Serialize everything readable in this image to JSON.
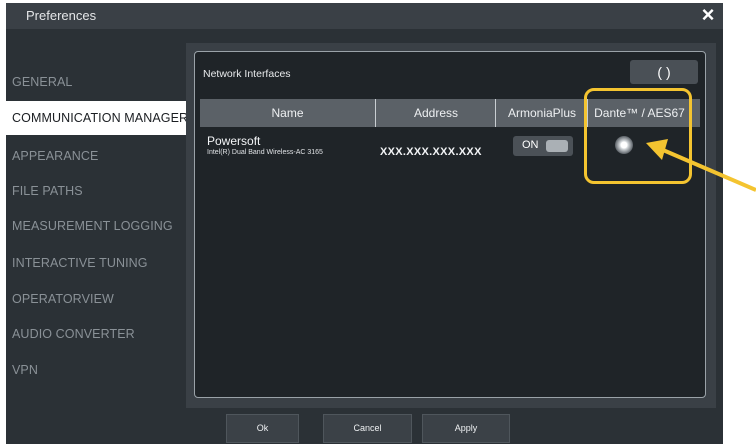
{
  "window": {
    "title": "Preferences",
    "close_icon": "×"
  },
  "sidebar": {
    "items": [
      {
        "label": "GENERAL",
        "active": false
      },
      {
        "label": "COMMUNICATION MANAGER",
        "active": true
      },
      {
        "label": "APPEARANCE",
        "active": false
      },
      {
        "label": "FILE PATHS",
        "active": false
      },
      {
        "label": "MEASUREMENT LOGGING",
        "active": false
      },
      {
        "label": "INTERACTIVE TUNING",
        "active": false
      },
      {
        "label": "OPERATORVIEW",
        "active": false
      },
      {
        "label": "AUDIO CONVERTER",
        "active": false
      },
      {
        "label": "VPN",
        "active": false
      }
    ]
  },
  "panel": {
    "label": "Network Interfaces",
    "refresh_icon": "refresh-icon",
    "refresh_glyph": "( )",
    "columns": [
      "Name",
      "Address",
      "ArmoniaPlus",
      "Dante™ / AES67"
    ],
    "rows": [
      {
        "name": "Powersoft",
        "adapter": "Intel(R) Dual Band Wireless-AC 3165",
        "address": "XXX.XXX.XXX.XXX",
        "armonia_toggle": "ON",
        "dante_selected": false
      }
    ]
  },
  "footer": {
    "ok": "Ok",
    "cancel": "Cancel",
    "apply": "Apply"
  },
  "colors": {
    "highlight": "#f4c430",
    "window_bg": "#2b3136",
    "active_nav_bg": "#ffffff"
  }
}
